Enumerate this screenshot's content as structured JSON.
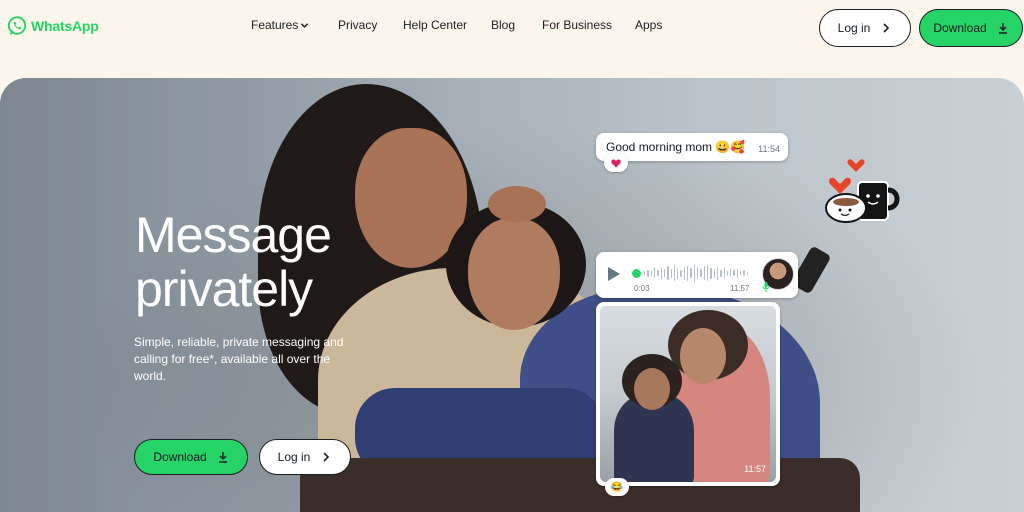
{
  "header": {
    "logo_text": "WhatsApp",
    "nav": [
      {
        "label": "Features",
        "has_dropdown": true
      },
      {
        "label": "Privacy"
      },
      {
        "label": "Help Center"
      },
      {
        "label": "Blog"
      },
      {
        "label": "For Business"
      },
      {
        "label": "Apps"
      }
    ],
    "login_label": "Log in",
    "download_label": "Download"
  },
  "hero": {
    "headline_line1": "Message",
    "headline_line2": "privately",
    "subtext": "Simple, reliable, private messaging and calling for free*, available all over the world.",
    "download_label": "Download",
    "login_label": "Log in"
  },
  "chat": {
    "message_text": "Good morning mom",
    "message_emojis": "😀🥰",
    "message_time": "11:54",
    "message_reaction": "❤",
    "voice_duration": "0:03",
    "voice_time": "11:57",
    "photo_time": "11:57",
    "photo_reaction": "😂"
  },
  "colors": {
    "brand_green": "#25d366",
    "page_bg": "#fcf5eb",
    "text_dark": "#1c1e21"
  },
  "icons": [
    "whatsapp-logo-icon",
    "chevron-down-icon",
    "chevron-right-icon",
    "download-icon",
    "play-icon",
    "mic-icon",
    "heart-icon"
  ]
}
